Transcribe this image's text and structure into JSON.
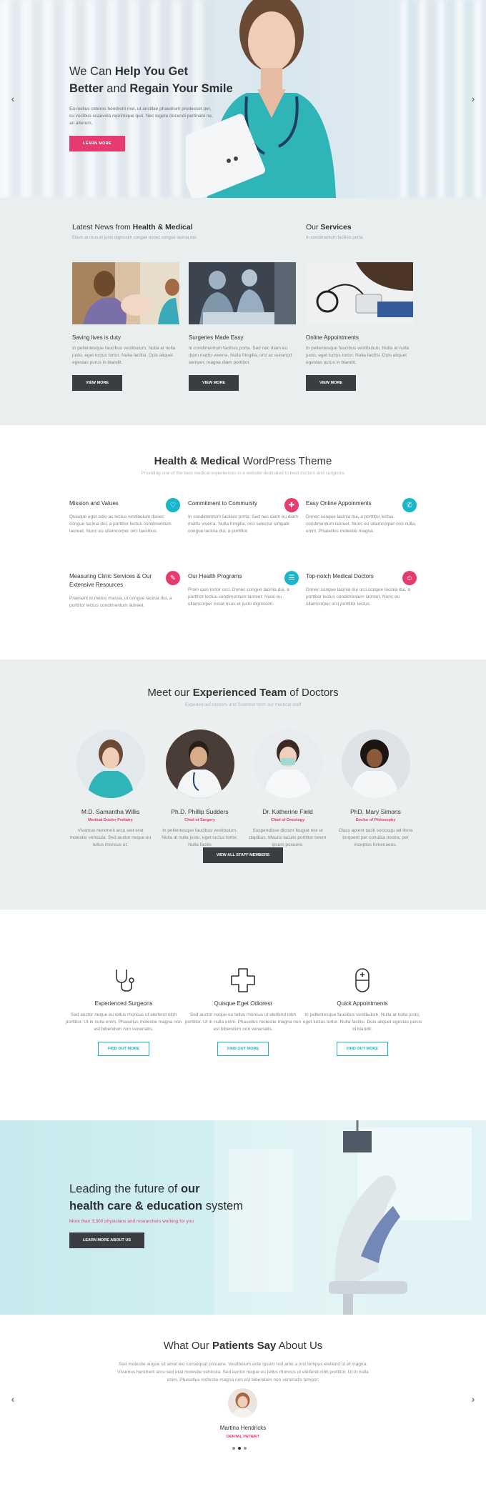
{
  "hero": {
    "title_l1_light": "We Can ",
    "title_l1_bold": "Help You Get",
    "title_l2_bold1": "Better",
    "title_l2_light": " and ",
    "title_l2_bold2": "Regain Your Smile",
    "desc": "Ea melius ceteros hendrerit mei, ut ancillae phaedrum prodesset per, cu vocibus scaevola reprimique quo. Nec legere docendi pertinato ne, an alterum.",
    "button": "LEARN MORE",
    "prev_icon": "‹",
    "next_icon": "›"
  },
  "news": {
    "heading_light": "Latest News from ",
    "heading_bold": "Health & Medical",
    "sub": "Etiam at risus et justo dignissim congue donec congue lacinia dui.",
    "services_light": "Our ",
    "services_bold": "Services",
    "services_sub": "In condimentum facilisis porta.",
    "cards": [
      {
        "title": "Saving lives is duty",
        "text": "In pellentesque faucibus vestibulum. Nulla at nulla justo, eget luctus tortor. Nulla facilisi. Duis aliquet egestas purus in blandit.",
        "button": "VIEW MORE"
      },
      {
        "title": "Surgeries Made Easy",
        "text": "In condimentum facilisis porta. Sed nec diam eu diam mattis viverra. Nulla fringilla, orci ac euismod semper, magna diam porttitor.",
        "button": "VIEW MORE"
      },
      {
        "title": "Online Appointments",
        "text": "In pellentesque faucibus vestibulum. Nulla at nulla justo, eget luctus tortor. Nulla facilisi. Duis aliquet egestas purus in blandit.",
        "button": "VIEW MORE"
      }
    ]
  },
  "theme": {
    "title_bold": "Health & Medical",
    "title_light": " WordPress Theme",
    "sub": "Providing one of the best medical experiences in a website dedicated to best doctors and surgeons",
    "features": [
      {
        "title": "Mission and Values",
        "text": "Quisque eget odio ac lectus vestibulum donec congue lacinia dui, a porttitor lectus condimentum laoreet. Nunc eu ullamcorper orci faucibus.",
        "icon": "♡"
      },
      {
        "title": "Commitment to Community",
        "text": "In condimentum facilisis porta. Sed nec diam eu diam mattis viverra. Nulla fringilla, orci selectur simpalir congue lacinia dui, a porttitor.",
        "icon": "✚"
      },
      {
        "title": "Easy Online Appoinments",
        "text": "Donec congue lacinia dui, a porttitor lectus condimentum laoreet. Nunc eu ullamcorper orci nulla enim. Phasellus molestie magna.",
        "icon": "✆"
      },
      {
        "title": "Measuring Clinic Services & Our Extensive Resources",
        "text": "Praesent id metus massa, ut congue lacinia dui, a porttitor lectus condimentum laoreet.",
        "icon": "✎"
      },
      {
        "title": "Our Health Programs",
        "text": "Proin quis tortor orci. Donec congue lacinia dui, a porttitor lectus condimentum laoreet. Nunc eu ullamcorper inciat risus et justo dignissim.",
        "icon": "☰"
      },
      {
        "title": "Top-notch Medical Doctors",
        "text": "Donec congue lacinia dui orci congue lacinia dui, a porttitor lectus condimentum laoreet. Nunc eu ullamcorper orci porttitor lectus.",
        "icon": "☺"
      }
    ]
  },
  "team": {
    "title_light1": "Meet our ",
    "title_bold": "Experienced Team",
    "title_light2": " of Doctors",
    "sub": "Experienced doctors and Scientist form our medical staff",
    "members": [
      {
        "name": "M.D. Samantha Willis",
        "role": "Medical Doctor Pediatry",
        "text": "Vivamus hendrerit arcu sed erat molestie vehicula. Sed auctor neque eu tellus rhoncus ut."
      },
      {
        "name": "Ph.D. Phillip Sudders",
        "role": "Chief of Surgery",
        "text": "In pellentesque faucibus vestibulum. Nulla at nulla justo, eget luctus tortor. Nulla facilis"
      },
      {
        "name": "Dr. Katherine Field",
        "role": "Chief of Oncology",
        "text": "Suspendisse dictum feugiat nisl ut dapibus. Mauris iaculis porttitor lorem ipsum posuere."
      },
      {
        "name": "PhD. Mary Simons",
        "role": "Doctor of Philosophy",
        "text": "Class aptent taciti sociosqu ad litora torquent per conubia nostra, per inceptos himenaeos."
      }
    ],
    "button": "VIEW ALL STAFF MEMBERS"
  },
  "icon_features": [
    {
      "title": "Experienced Surgeons",
      "text": "Sed auctor neque eu tellus rhoncus ut eleifend nibh porttitor. Ut in nulla enim. Phasellus molestie magna non est bibendum non venenatis.",
      "button": "FIND OUT MORE",
      "icon": "stethoscope-icon"
    },
    {
      "title": "Quisque Eget Odiorest",
      "text": "Sed auctor neque eu tellus rhoncus ut eleifend nibh porttitor. Ut in nulla enim. Phasellus molestie magna non est bibendum non venenatis.",
      "button": "FIND OUT MORE",
      "icon": "medical-cross-icon"
    },
    {
      "title": "Quick Appointments",
      "text": "In pellentesque faucibus vestibulum. Nulla at nulla justo, eget luctus tortor. Nulla facilisi. Duis aliquet egestas purus in blandit.",
      "button": "FIND OUT MORE",
      "icon": "capsule-icon"
    }
  ],
  "lead": {
    "l1_light": "Leading the future of ",
    "l1_bold": "our",
    "l2_bold": "health care & education",
    "l2_light": " system",
    "sub": "More than 3,300 physicians and researchers working for you",
    "button": "LEARN MORE ABOUT US"
  },
  "testimonial": {
    "title_light1": "What Our ",
    "title_bold": "Patients Say",
    "title_light2": " About Us",
    "quote": "Sed molestie augue sit amet leo consequat posuere. Vestibulum ante ipsum nisl ante a orci tempus eleifend ut et magna. Vivamus hendrerit arcu sed erat molestie vehicula. Sed auctor neque eu tellus rhoncus ut eleifend nibh porttitor. Ut in nulla enim. Phasellus molestie magna non est bibendum non venenatis tempor.",
    "name": "Martina Hendricks",
    "role": "DENTAL PATIENT",
    "prev_icon": "‹",
    "next_icon": "›"
  },
  "colors": {
    "accent_pink": "#e63b6e",
    "accent_teal": "#19b6c9",
    "dark_button": "#3a3d42"
  }
}
